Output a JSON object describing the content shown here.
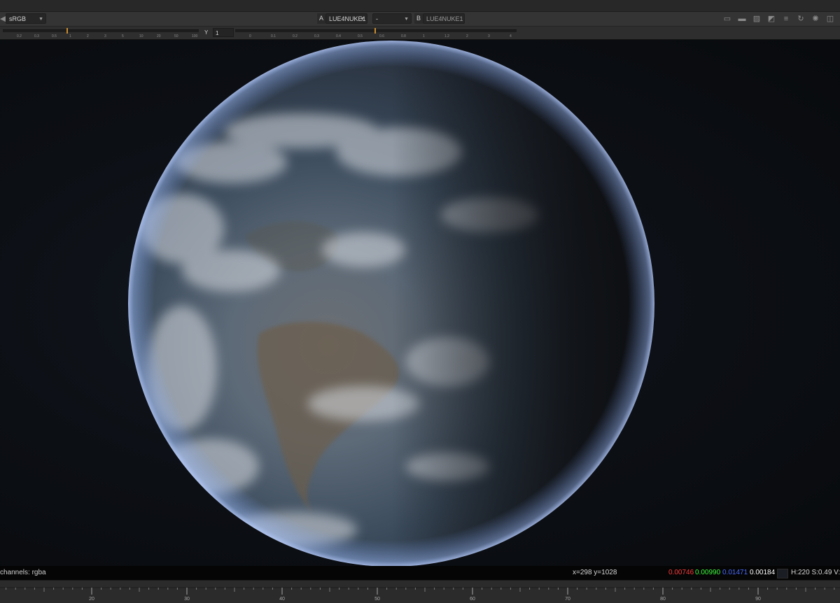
{
  "viewer": {
    "colorspace": "sRGB",
    "input_a": {
      "label": "A",
      "node": "LUE4NUKE1"
    },
    "wipe_mode": "-",
    "input_b": {
      "label": "B",
      "node": "LUE4NUKE1"
    },
    "y_label": "Y",
    "y_value": "1",
    "icons": [
      "roi-icon",
      "fit-icon",
      "clipping-warning-icon",
      "proxy-icon",
      "overlay-icon",
      "refresh-icon",
      "pause-icon",
      "stereo-icon"
    ]
  },
  "gain_slider": {
    "ticks": [
      "0.2",
      "0.3",
      "0.5",
      "1",
      "2",
      "3",
      "5",
      "10",
      "20",
      "50",
      "100"
    ]
  },
  "gamma_slider": {
    "ticks": [
      "0",
      "0.1",
      "0.2",
      "0.3",
      "0.4",
      "0.5",
      "0.6",
      "0.8",
      "1",
      "1.2",
      "2",
      "3",
      "4"
    ]
  },
  "status": {
    "channels": "channels: rgba",
    "coords": "x=298 y=1028",
    "r": "0.00746",
    "g": "0.00990",
    "b": "0.01471",
    "a": "0.00184",
    "hsv": "H:220 S:0.49 V:",
    "colors": {
      "r": "#ff3b3b",
      "g": "#3cff3c",
      "b": "#4a6bff",
      "a": "#ffffff"
    }
  },
  "timeline": {
    "labels": [
      "20",
      "30",
      "40",
      "50",
      "60",
      "70",
      "80",
      "90"
    ]
  }
}
